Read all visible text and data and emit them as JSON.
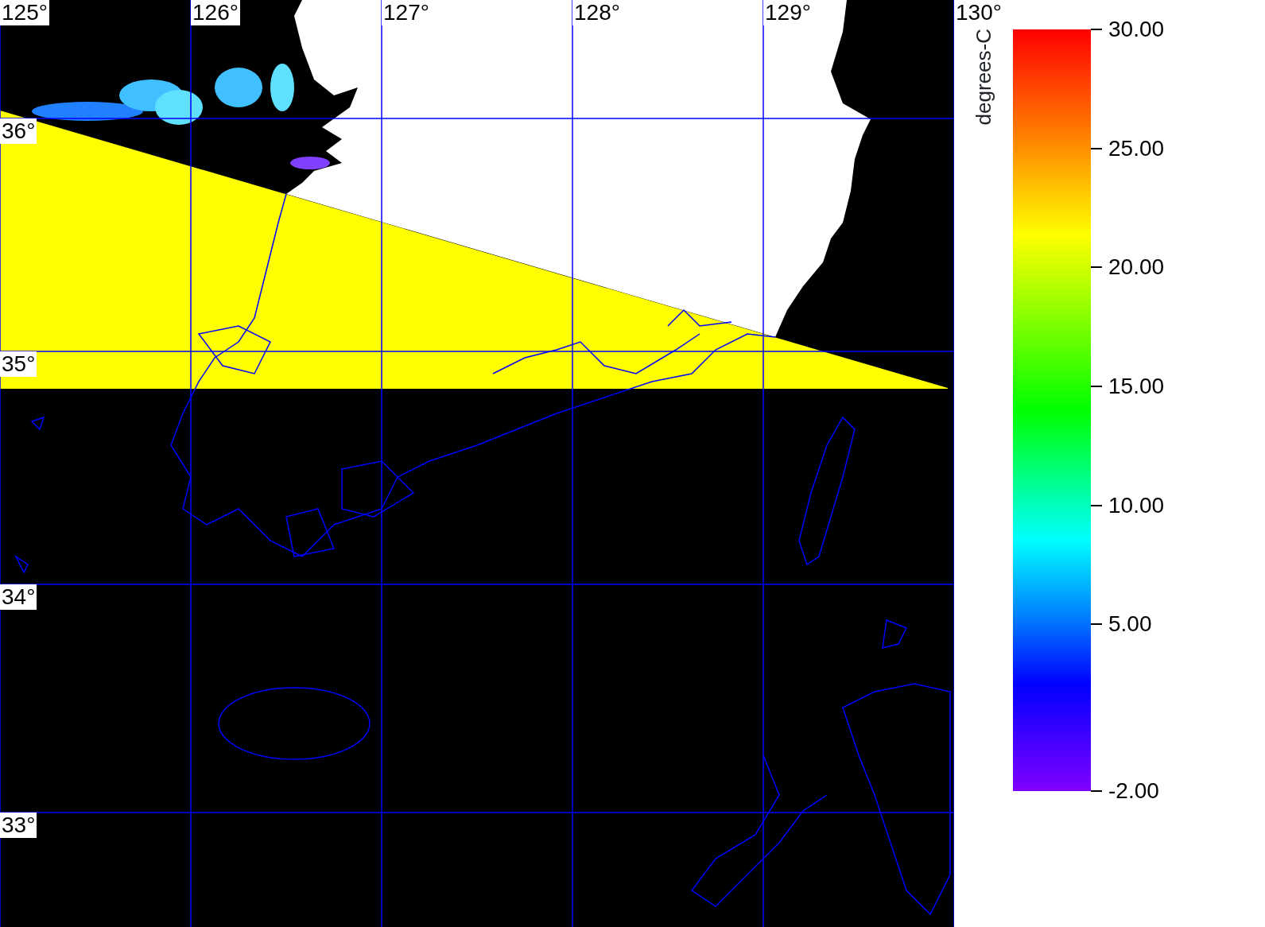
{
  "map": {
    "longitude_labels": [
      "125°",
      "126°",
      "127°",
      "128°",
      "129°",
      "130°"
    ],
    "latitude_labels": [
      "36°",
      "35°",
      "34°",
      "33°"
    ]
  },
  "legend": {
    "units": "degrees-C",
    "tick_labels": [
      "30.00",
      "25.00",
      "20.00",
      "15.00",
      "10.00",
      "5.00",
      "-2.00"
    ]
  }
}
